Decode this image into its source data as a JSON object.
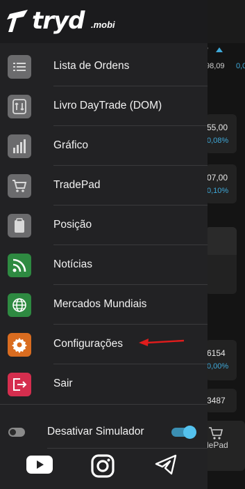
{
  "app": {
    "logo_text": "tryd",
    "logo_suffix": ".mobi"
  },
  "menu": {
    "items": [
      {
        "label": "Lista de Ordens",
        "icon": "list-icon",
        "color": "#6b6b6d"
      },
      {
        "label": "Livro DayTrade (DOM)",
        "icon": "swap-arrows-icon",
        "color": "#6b6b6d"
      },
      {
        "label": "Gráfico",
        "icon": "bar-chart-icon",
        "color": "#6b6b6d"
      },
      {
        "label": "TradePad",
        "icon": "cart-icon",
        "color": "#6b6b6d"
      },
      {
        "label": "Posição",
        "icon": "clipboard-icon",
        "color": "#6b6b6d"
      },
      {
        "label": "Notícias",
        "icon": "rss-icon",
        "color": "#2e8a41"
      },
      {
        "label": "Mercados Mundiais",
        "icon": "globe-icon",
        "color": "#2e8a41"
      },
      {
        "label": "Configurações",
        "icon": "gear-icon",
        "color": "#d96c20"
      },
      {
        "label": "Sair",
        "icon": "exit-icon",
        "color": "#d52e4e"
      }
    ]
  },
  "simulator": {
    "label": "Desativar Simulador",
    "toggle_on": true
  },
  "social": [
    "youtube-icon",
    "instagram-icon",
    "telegram-icon"
  ],
  "background": {
    "header_values": [
      "98,09",
      "0,0"
    ],
    "cards": [
      {
        "value": "55,00",
        "pct": "0,08%"
      },
      {
        "value": "07,00",
        "pct": "0,10%"
      },
      {
        "value": "6154",
        "pct": "0,00%"
      },
      {
        "value": "3487",
        "pct": ""
      }
    ],
    "tradepad_label": "dePad"
  }
}
